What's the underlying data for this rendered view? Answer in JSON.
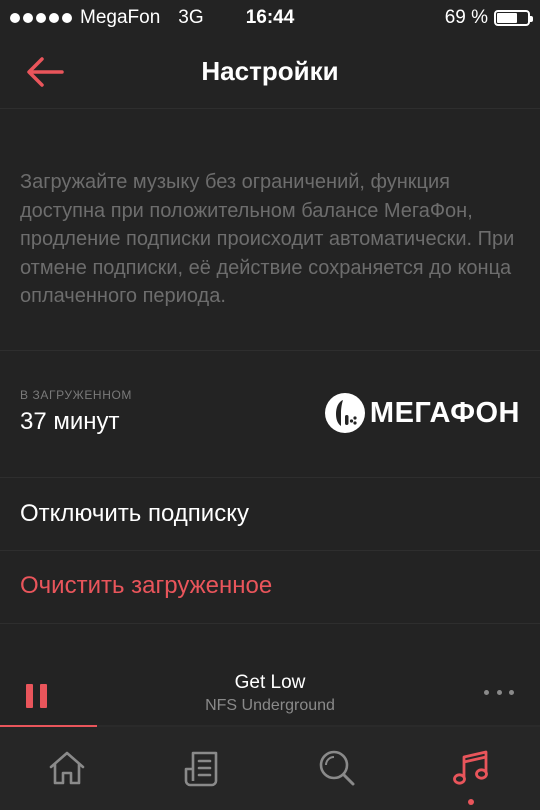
{
  "status_bar": {
    "carrier": "MegaFon",
    "network": "3G",
    "time": "16:44",
    "battery": "69 %",
    "battery_level": 0.69,
    "signal_bars": 5
  },
  "header": {
    "title": "Настройки",
    "back_icon": "arrow-left-icon"
  },
  "description": "Загружайте музыку без ограничений, функция доступна при положительном балансе МегаФон, продление подписки происходит автоматически. При отмене подписки, её действие сохраняется до конца оплаченного периода.",
  "downloaded": {
    "label": "В ЗАГРУЖЕННОМ",
    "value": "37 минут"
  },
  "provider_logo": {
    "text": "МЕГАФОН",
    "icon": "megafon-logo-icon"
  },
  "menu": {
    "unsubscribe": "Отключить подписку",
    "clear_downloads": "Очистить загруженное"
  },
  "player": {
    "track_title": "Get Low",
    "track_artist": "NFS Underground",
    "progress": 0.18,
    "pause_icon": "pause-icon",
    "more_icon": "more-horizontal-icon"
  },
  "tabs": [
    {
      "name": "home",
      "icon": "home-icon",
      "active": false
    },
    {
      "name": "feed",
      "icon": "feed-icon",
      "active": false
    },
    {
      "name": "search",
      "icon": "search-icon",
      "active": false
    },
    {
      "name": "music",
      "icon": "music-note-icon",
      "active": true
    }
  ],
  "colors": {
    "accent": "#e9555b",
    "background": "#232323",
    "text_secondary": "#6d6d6d"
  }
}
